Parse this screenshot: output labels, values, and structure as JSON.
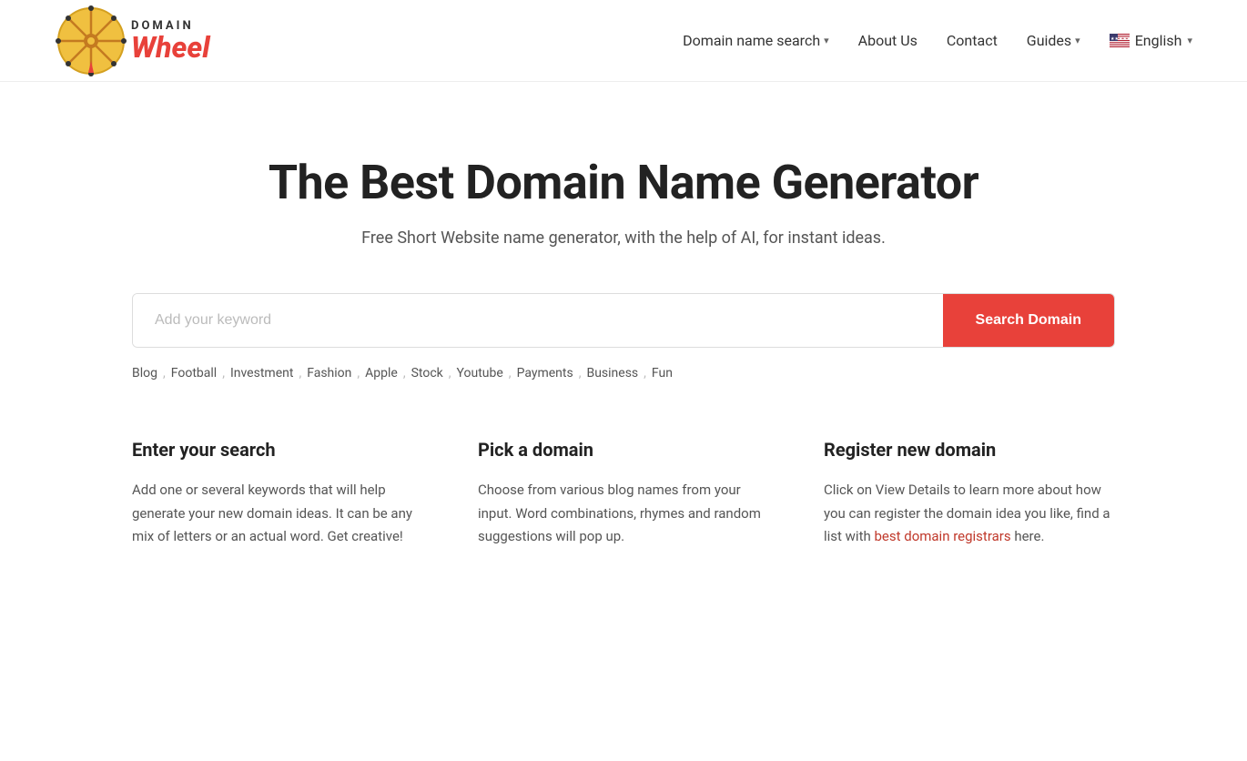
{
  "header": {
    "logo_domain": "DOMAIN",
    "logo_wheel": "Wheel",
    "nav": {
      "domain_search_label": "Domain name search",
      "about_label": "About Us",
      "contact_label": "Contact",
      "guides_label": "Guides",
      "lang_label": "English"
    }
  },
  "hero": {
    "title": "The Best Domain Name Generator",
    "subtitle": "Free Short Website name generator, with the help of AI, for instant ideas."
  },
  "search": {
    "placeholder": "Add your keyword",
    "button_label": "Search Domain"
  },
  "tags": [
    "Blog",
    "Football",
    "Investment",
    "Fashion",
    "Apple",
    "Stock",
    "Youtube",
    "Payments",
    "Business",
    "Fun"
  ],
  "columns": [
    {
      "id": "enter-search",
      "title": "Enter your search",
      "text": "Add one or several keywords that will help generate your new domain ideas. It can be any mix of letters or an actual word. Get creative!",
      "link": null,
      "link_text": null,
      "after_link": null
    },
    {
      "id": "pick-domain",
      "title": "Pick a domain",
      "text": "Choose from various blog names from your input. Word combinations, rhymes and random suggestions will pop up.",
      "link": null,
      "link_text": null,
      "after_link": null
    },
    {
      "id": "register-domain",
      "title": "Register new domain",
      "text_before": "Click on View Details to learn more about how you can register the domain idea you like, find a list with ",
      "link_text": "best domain registrars",
      "link_href": "#",
      "text_after": " here."
    }
  ]
}
